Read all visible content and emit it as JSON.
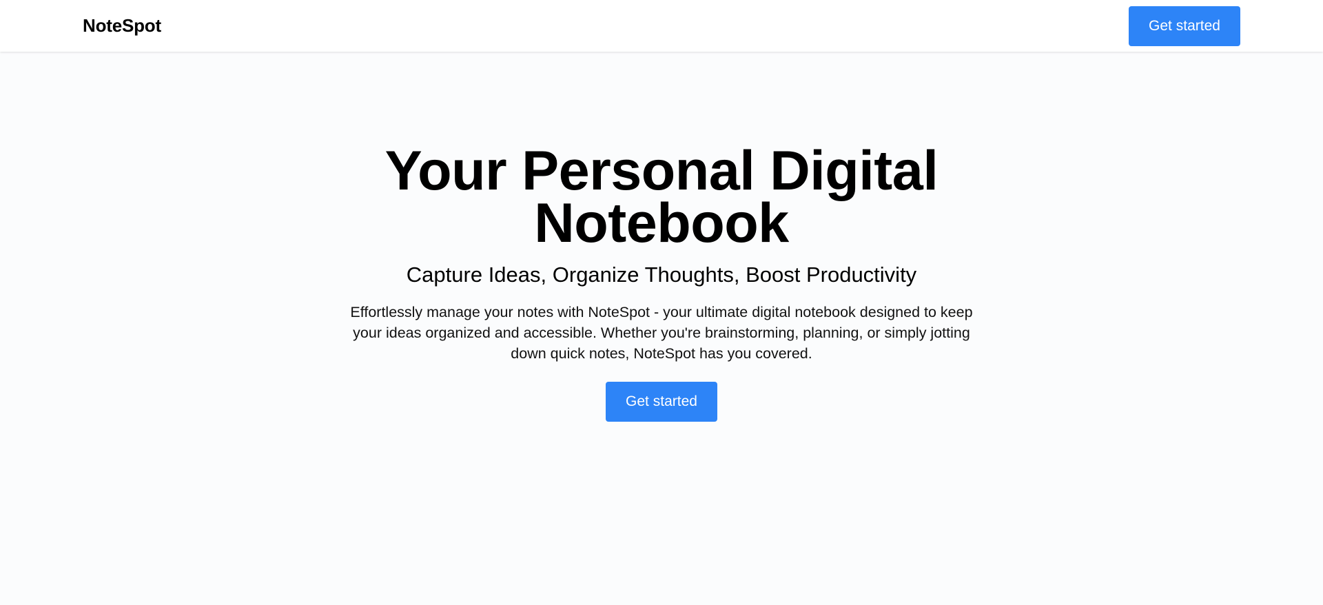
{
  "navbar": {
    "brand": "NoteSpot",
    "cta_label": "Get started"
  },
  "hero": {
    "title": "Your Personal Digital Notebook",
    "subtitle": "Capture Ideas, Organize Thoughts, Boost Productivity",
    "description": "Effortlessly manage your notes with NoteSpot - your ultimate digital notebook designed to keep your ideas organized and accessible. Whether you're brainstorming, planning, or simply jotting down quick notes, NoteSpot has you covered.",
    "cta_label": "Get started"
  },
  "colors": {
    "accent": "#2d84f7",
    "background": "#fbfcfd",
    "navbar": "#ffffff"
  }
}
